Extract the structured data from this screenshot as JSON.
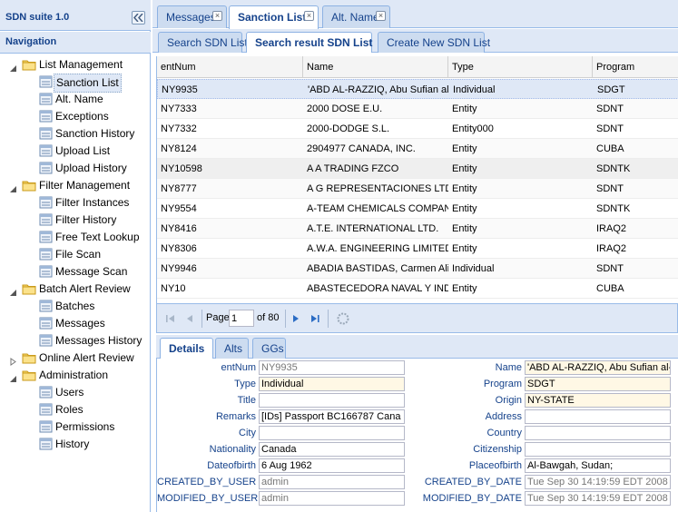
{
  "app": {
    "title": "SDN suite 1.0",
    "nav_header": "Navigation"
  },
  "tree": [
    {
      "label": "List Management",
      "type": "folder",
      "children": [
        "Sanction List",
        "Alt. Name",
        "Exceptions",
        "Sanction History",
        "Upload List",
        "Upload History"
      ]
    },
    {
      "label": "Filter Management",
      "type": "folder",
      "children": [
        "Filter Instances",
        "Filter History",
        "Free Text Lookup",
        "File Scan",
        "Message Scan"
      ]
    },
    {
      "label": "Batch Alert Review",
      "type": "folder",
      "children": [
        "Batches",
        "Messages",
        "Messages History"
      ]
    },
    {
      "label": "Online Alert Review",
      "type": "folder",
      "collapsed": true,
      "children": []
    },
    {
      "label": "Administration",
      "type": "folder",
      "children": [
        "Users",
        "Roles",
        "Permissions",
        "History"
      ]
    }
  ],
  "selected_tree_item": "Sanction List",
  "tabs": [
    {
      "label": "Messages",
      "closable": true,
      "active": false
    },
    {
      "label": "Sanction List",
      "closable": true,
      "active": true
    },
    {
      "label": "Alt. Name",
      "closable": true,
      "active": false
    }
  ],
  "subtabs": [
    {
      "label": "Search SDN List",
      "active": false
    },
    {
      "label": "Search result SDN List",
      "active": true
    },
    {
      "label": "Create New SDN List",
      "active": false
    }
  ],
  "grid": {
    "columns": [
      "entNum",
      "Name",
      "Type",
      "Program"
    ],
    "rows": [
      [
        "NY9935",
        "'ABD AL-RAZZIQ, Abu Sufian al",
        "Individual",
        "SDGT"
      ],
      [
        "NY7333",
        "2000 DOSE E.U.",
        "Entity",
        "SDNT"
      ],
      [
        "NY7332",
        "2000-DODGE S.L.",
        "Entity000",
        "SDNT"
      ],
      [
        "NY8124",
        "2904977 CANADA, INC.",
        "Entity",
        "CUBA"
      ],
      [
        "NY10598",
        "A A TRADING FZCO",
        "Entity",
        "SDNTK"
      ],
      [
        "NY8777",
        "A G REPRESENTACIONES LTDA",
        "Entity",
        "SDNT"
      ],
      [
        "NY9554",
        "A-TEAM CHEMICALS COMPANY",
        "Entity",
        "SDNTK"
      ],
      [
        "NY8416",
        "A.T.E. INTERNATIONAL LTD.",
        "Entity",
        "IRAQ2"
      ],
      [
        "NY8306",
        "A.W.A. ENGINEERING LIMITED",
        "Entity",
        "IRAQ2"
      ],
      [
        "NY9946",
        "ABADIA BASTIDAS, Carmen Alic",
        "Individual",
        "SDNT"
      ],
      [
        "NY10",
        "ABASTECEDORA NAVAL Y IND",
        "Entity",
        "CUBA"
      ]
    ]
  },
  "pager": {
    "page_label": "Page",
    "page_value": "1",
    "of_label": "of 80"
  },
  "detail_tabs": [
    {
      "label": "Details",
      "active": true
    },
    {
      "label": "Alts",
      "active": false
    },
    {
      "label": "GGs",
      "active": false
    }
  ],
  "details": {
    "left": [
      {
        "label": "entNum",
        "value": "NY9935",
        "style": "ro"
      },
      {
        "label": "Type",
        "value": "Individual",
        "style": "ylw"
      },
      {
        "label": "Title",
        "value": "",
        "style": ""
      },
      {
        "label": "Remarks",
        "value": "[IDs] Passport  BC166787  Cana",
        "style": ""
      },
      {
        "label": "City",
        "value": "",
        "style": ""
      },
      {
        "label": "Nationality",
        "value": "Canada",
        "style": ""
      },
      {
        "label": "Dateofbirth",
        "value": "6 Aug 1962",
        "style": ""
      },
      {
        "label": "CREATED_BY_USER",
        "value": "admin",
        "style": "ro"
      },
      {
        "label": "MODIFIED_BY_USER",
        "value": "admin",
        "style": "ro"
      }
    ],
    "right": [
      {
        "label": "Name",
        "value": "'ABD AL-RAZZIQ, Abu Sufian al-S",
        "style": "ylw"
      },
      {
        "label": "Program",
        "value": "SDGT",
        "style": "ylw"
      },
      {
        "label": "Origin",
        "value": "NY-STATE",
        "style": "ylw"
      },
      {
        "label": "Address",
        "value": "",
        "style": ""
      },
      {
        "label": "Country",
        "value": "",
        "style": ""
      },
      {
        "label": "Citizenship",
        "value": "",
        "style": ""
      },
      {
        "label": "Placeofbirth",
        "value": "Al-Bawgah, Sudan;",
        "style": ""
      },
      {
        "label": "CREATED_BY_DATE",
        "value": "Tue Sep 30 14:19:59 EDT 2008",
        "style": "ro"
      },
      {
        "label": "MODIFIED_BY_DATE",
        "value": "Tue Sep 30 14:19:59 EDT 2008",
        "style": "ro"
      }
    ]
  },
  "icons": {
    "collapse": "double-chevron-left-icon",
    "folder": "folder-icon",
    "leaf": "list-page-icon",
    "first": "first-page-icon",
    "prev": "prev-page-icon",
    "next": "next-page-icon",
    "last": "last-page-icon",
    "refresh": "refresh-icon"
  },
  "colors": {
    "accent": "#15428b",
    "panel": "#dfe8f6",
    "border": "#99bbe8",
    "highlight_field": "#fff8e5"
  }
}
